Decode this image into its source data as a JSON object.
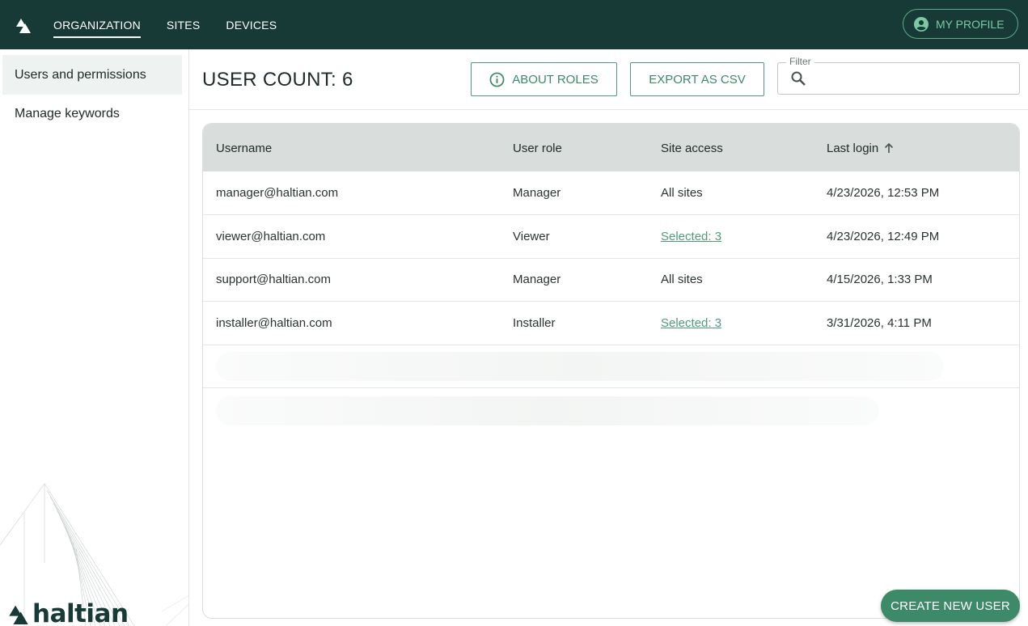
{
  "topbar": {
    "nav": [
      {
        "label": "ORGANIZATION",
        "active": true
      },
      {
        "label": "SITES",
        "active": false
      },
      {
        "label": "DEVICES",
        "active": false
      }
    ],
    "profile_label": "MY PROFILE",
    "icons": {
      "logo": "haltian-logo-icon",
      "profile": "account-circle-icon"
    }
  },
  "sidebar": {
    "items": [
      {
        "label": "Users and permissions",
        "active": true
      },
      {
        "label": "Manage keywords",
        "active": false
      }
    ],
    "brand": "haltian"
  },
  "header": {
    "user_count": "USER COUNT: 6",
    "about_roles_label": "ABOUT ROLES",
    "export_label": "EXPORT AS CSV",
    "filter_label": "Filter",
    "filter_value": ""
  },
  "table": {
    "columns": [
      "Username",
      "User role",
      "Site access",
      "Last login"
    ],
    "sort": {
      "column": "Last login",
      "direction": "ascending-arrow-icon"
    },
    "rows": [
      {
        "username": "manager@haltian.com",
        "role": "Manager",
        "site_access": "All sites",
        "last_login": "4/23/2026, 12:53 PM"
      },
      {
        "username": "viewer@haltian.com",
        "role": "Viewer",
        "site_access": "Selected: 3",
        "last_login": "4/23/2026, 12:49 PM"
      },
      {
        "username": "support@haltian.com",
        "role": "Manager",
        "site_access": "All sites",
        "last_login": "4/15/2026, 1:33 PM"
      },
      {
        "username": "installer@haltian.com",
        "role": "Installer",
        "site_access": "Selected: 3",
        "last_login": "3/31/2026, 4:11 PM"
      }
    ]
  },
  "create_button_label": "CREATE NEW USER",
  "colors": {
    "topbar": "#173a36",
    "accent": "#3d8a68",
    "header_row": "#d9dddc"
  }
}
